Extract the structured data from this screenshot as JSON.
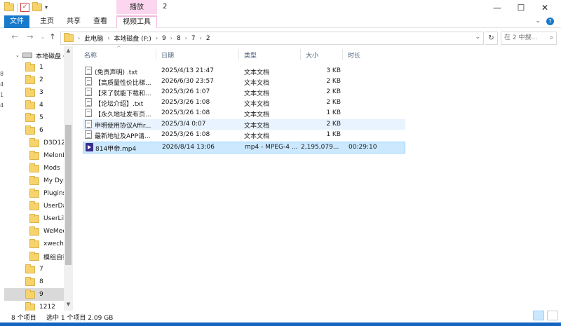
{
  "window": {
    "title": "2",
    "context_tab_title": "播放"
  },
  "ribbon": {
    "tabs": [
      "文件",
      "主页",
      "共享",
      "查看",
      "视频工具"
    ]
  },
  "address": {
    "crumbs": [
      "此电脑",
      "本地磁盘 (F:)",
      "9",
      "8",
      "7",
      "2"
    ],
    "search_placeholder": "在 2 中搜..."
  },
  "nav": {
    "drive": "本地磁盘 (F",
    "items": [
      "1",
      "2",
      "3",
      "4",
      "5",
      "6",
      "D3D12",
      "MelonLo",
      "Mods",
      "My Dyst",
      "Plugins",
      "UserDat",
      "UserLibs",
      "WeMeet",
      "xwechat",
      "模组自行",
      "7",
      "8",
      "9",
      "1212"
    ],
    "selected": "9"
  },
  "columns": {
    "name": "名称",
    "date": "日期",
    "type": "类型",
    "size": "大小",
    "duration": "时长"
  },
  "files": [
    {
      "name": "(免责声明) .txt",
      "date": "2025/4/13 21:47",
      "type": "文本文档",
      "size": "3 KB",
      "duration": "",
      "icon": "text-file-icon"
    },
    {
      "name": "【高质量性价比梯...",
      "date": "2026/6/30 23:57",
      "type": "文本文档",
      "size": "2 KB",
      "duration": "",
      "icon": "text-file-icon"
    },
    {
      "name": "【来了就能下载和...",
      "date": "2025/3/26 1:07",
      "type": "文本文档",
      "size": "2 KB",
      "duration": "",
      "icon": "text-file-icon"
    },
    {
      "name": "【论坛介绍】.txt",
      "date": "2025/3/26 1:08",
      "type": "文本文档",
      "size": "2 KB",
      "duration": "",
      "icon": "text-file-icon"
    },
    {
      "name": "【永久地址发布页...",
      "date": "2025/3/26 1:08",
      "type": "文本文档",
      "size": "1 KB",
      "duration": "",
      "icon": "text-file-icon"
    },
    {
      "name": "申明使用协议Affir...",
      "date": "2025/3/4 0:07",
      "type": "文本文档",
      "size": "2 KB",
      "duration": "",
      "icon": "text-file-icon"
    },
    {
      "name": "最新地址及APP请...",
      "date": "2025/3/26 1:08",
      "type": "文本文档",
      "size": "1 KB",
      "duration": "",
      "icon": "text-file-icon"
    },
    {
      "name": "814甲帝.mp4",
      "date": "2026/8/14 13:06",
      "type": "mp4 - MPEG-4 ...",
      "size": "2,195,079...",
      "duration": "00:29:10",
      "icon": "video-file-icon"
    }
  ],
  "status": {
    "count": "8 个项目",
    "selection": "选中 1 个项目  2.09 GB"
  }
}
